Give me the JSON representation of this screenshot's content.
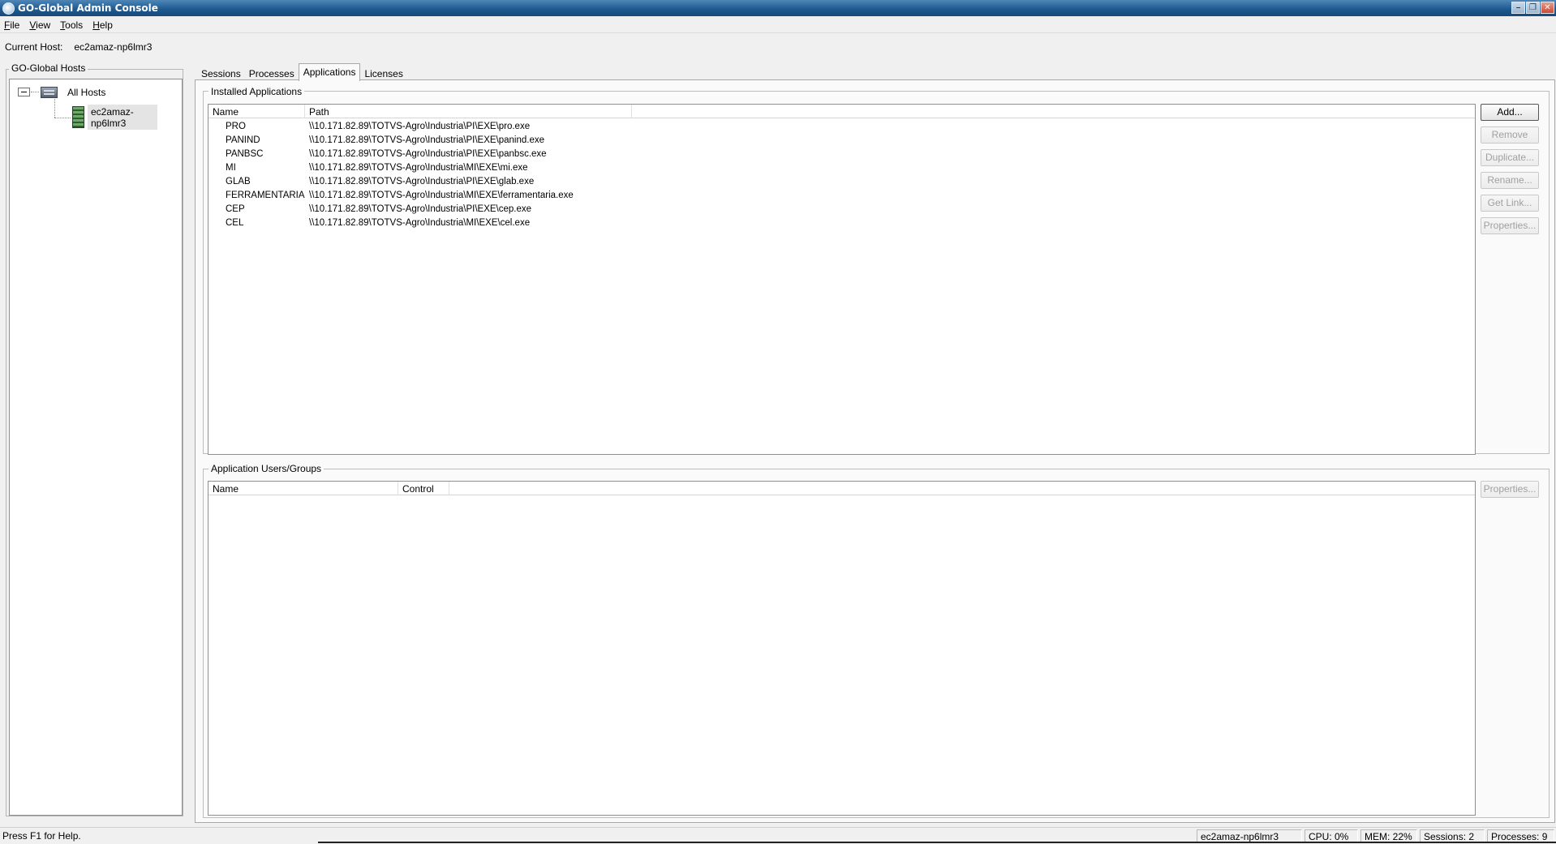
{
  "window": {
    "title": "GO-Global Admin Console",
    "controls": [
      "minimize",
      "restore",
      "close"
    ]
  },
  "menu": [
    {
      "label": "File",
      "mnemonic": "F",
      "rest": "ile"
    },
    {
      "label": "View",
      "mnemonic": "V",
      "rest": "iew"
    },
    {
      "label": "Tools",
      "mnemonic": "T",
      "rest": "ools"
    },
    {
      "label": "Help",
      "mnemonic": "H",
      "rest": "elp"
    }
  ],
  "current_host": {
    "label": "Current Host:",
    "value": "ec2amaz-np6lmr3"
  },
  "hosts_panel": {
    "title": "GO-Global Hosts",
    "root": "All Hosts",
    "hosts": [
      "ec2amaz-np6lmr3"
    ]
  },
  "tabs": [
    {
      "label": "Sessions",
      "active": false
    },
    {
      "label": "Processes",
      "active": false
    },
    {
      "label": "Applications",
      "active": true
    },
    {
      "label": "Licenses",
      "active": false
    }
  ],
  "installed_apps": {
    "title": "Installed Applications",
    "columns": [
      "Name",
      "Path"
    ],
    "rows": [
      {
        "name": "PRO",
        "path": "\\\\10.171.82.89\\TOTVS-Agro\\Industria\\PI\\EXE\\pro.exe"
      },
      {
        "name": "PANIND",
        "path": "\\\\10.171.82.89\\TOTVS-Agro\\Industria\\PI\\EXE\\panind.exe"
      },
      {
        "name": "PANBSC",
        "path": "\\\\10.171.82.89\\TOTVS-Agro\\Industria\\PI\\EXE\\panbsc.exe"
      },
      {
        "name": "MI",
        "path": "\\\\10.171.82.89\\TOTVS-Agro\\Industria\\MI\\EXE\\mi.exe"
      },
      {
        "name": "GLAB",
        "path": "\\\\10.171.82.89\\TOTVS-Agro\\Industria\\PI\\EXE\\glab.exe"
      },
      {
        "name": "FERRAMENTARIA",
        "path": "\\\\10.171.82.89\\TOTVS-Agro\\Industria\\MI\\EXE\\ferramentaria.exe"
      },
      {
        "name": "CEP",
        "path": "\\\\10.171.82.89\\TOTVS-Agro\\Industria\\PI\\EXE\\cep.exe"
      },
      {
        "name": "CEL",
        "path": "\\\\10.171.82.89\\TOTVS-Agro\\Industria\\MI\\EXE\\cel.exe"
      }
    ],
    "buttons": {
      "add": "Add...",
      "remove": "Remove",
      "duplicate": "Duplicate...",
      "rename": "Rename...",
      "get_link": "Get Link...",
      "properties": "Properties..."
    }
  },
  "app_users": {
    "title": "Application Users/Groups",
    "columns": [
      "Name",
      "Control"
    ],
    "rows": [],
    "buttons": {
      "properties": "Properties..."
    }
  },
  "statusbar": {
    "help": "Press F1 for Help.",
    "host": "ec2amaz-np6lmr3",
    "cpu": "CPU: 0%",
    "mem": "MEM: 22%",
    "sessions": "Sessions: 2",
    "processes": "Processes: 9"
  }
}
